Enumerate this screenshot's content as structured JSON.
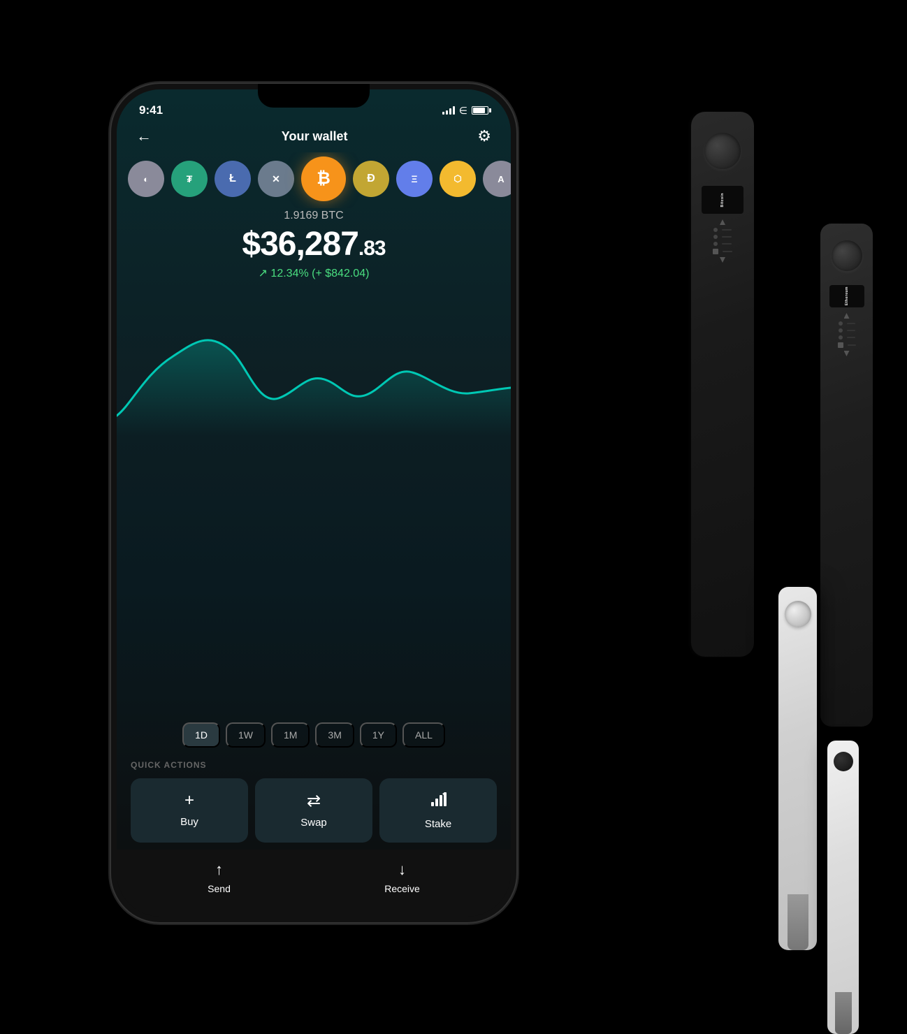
{
  "statusBar": {
    "time": "9:41"
  },
  "header": {
    "back_label": "←",
    "title": "Your wallet",
    "settings_icon": "⚙"
  },
  "coins": [
    {
      "id": "partial",
      "symbol": "◐",
      "class": "coin-partial"
    },
    {
      "id": "tether",
      "symbol": "₮",
      "class": "coin-tether"
    },
    {
      "id": "litecoin",
      "symbol": "Ł",
      "class": "coin-litecoin"
    },
    {
      "id": "xrp",
      "symbol": "✕",
      "class": "coin-xrp"
    },
    {
      "id": "bitcoin",
      "symbol": "₿",
      "class": "coin-bitcoin"
    },
    {
      "id": "doge",
      "symbol": "Ð",
      "class": "coin-doge"
    },
    {
      "id": "ethereum",
      "symbol": "Ξ",
      "class": "coin-eth"
    },
    {
      "id": "bnb",
      "symbol": "⬡",
      "class": "coin-bnb"
    },
    {
      "id": "algo",
      "symbol": "A",
      "class": "coin-partial"
    }
  ],
  "balance": {
    "btc_amount": "1.9169 BTC",
    "usd_main": "$36,287",
    "usd_cents": ".83",
    "change_text": "↗ 12.34% (+ $842.04)"
  },
  "timeFilters": [
    {
      "id": "1d",
      "label": "1D",
      "active": true
    },
    {
      "id": "1w",
      "label": "1W",
      "active": false
    },
    {
      "id": "1m",
      "label": "1M",
      "active": false
    },
    {
      "id": "3m",
      "label": "3M",
      "active": false
    },
    {
      "id": "1y",
      "label": "1Y",
      "active": false
    },
    {
      "id": "all",
      "label": "ALL",
      "active": false
    }
  ],
  "quickActions": {
    "section_label": "QUICK ACTIONS",
    "buttons": [
      {
        "id": "buy",
        "icon": "+",
        "label": "Buy"
      },
      {
        "id": "swap",
        "icon": "⇄",
        "label": "Swap"
      },
      {
        "id": "stake",
        "icon": "📶",
        "label": "Stake"
      }
    ]
  },
  "bottomActions": [
    {
      "id": "send",
      "icon": "↑",
      "label": "Send"
    },
    {
      "id": "receive",
      "icon": "↓",
      "label": "Receive"
    }
  ],
  "colors": {
    "accent_teal": "#00c8b4",
    "positive_green": "#4ade80",
    "bg_dark": "#0a1f24",
    "bg_screen": "#0d1f24"
  }
}
